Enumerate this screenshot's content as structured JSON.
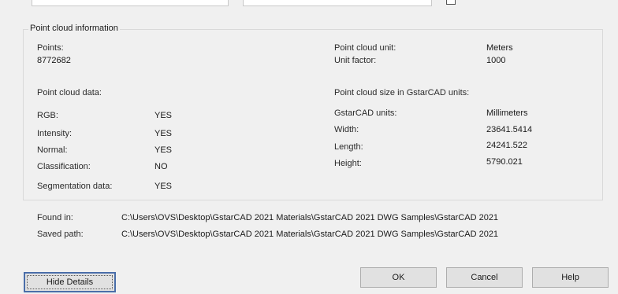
{
  "group": {
    "title": "Point cloud information"
  },
  "points": {
    "label": "Points:",
    "value": "8772682"
  },
  "unit": {
    "label": "Point cloud unit:",
    "value": "Meters",
    "factor_label": "Unit factor:",
    "factor_value": "1000"
  },
  "data_section": {
    "title": "Point cloud data:",
    "rows": [
      {
        "label": "RGB:",
        "value": "YES"
      },
      {
        "label": "Intensity:",
        "value": "YES"
      },
      {
        "label": "Normal:",
        "value": "YES"
      },
      {
        "label": "Classification:",
        "value": "NO"
      },
      {
        "label": "Segmentation data:",
        "value": "YES"
      }
    ]
  },
  "size_section": {
    "title": "Point cloud size in GstarCAD units:",
    "rows": [
      {
        "label": "GstarCAD units:",
        "value": "Millimeters"
      },
      {
        "label": "Width:",
        "value": "23641.5414"
      },
      {
        "label": "Length:",
        "value": "24241.522"
      },
      {
        "label": "Height:",
        "value": "5790.021"
      }
    ]
  },
  "paths": {
    "found_label": "Found in:",
    "found_value": "C:\\Users\\OVS\\Desktop\\GstarCAD 2021 Materials\\GstarCAD 2021 DWG Samples\\GstarCAD 2021",
    "saved_label": "Saved path:",
    "saved_value": "C:\\Users\\OVS\\Desktop\\GstarCAD 2021 Materials\\GstarCAD 2021 DWG Samples\\GstarCAD 2021"
  },
  "buttons": {
    "hide_details": "Hide Details",
    "ok": "OK",
    "cancel": "Cancel",
    "help": "Help"
  }
}
